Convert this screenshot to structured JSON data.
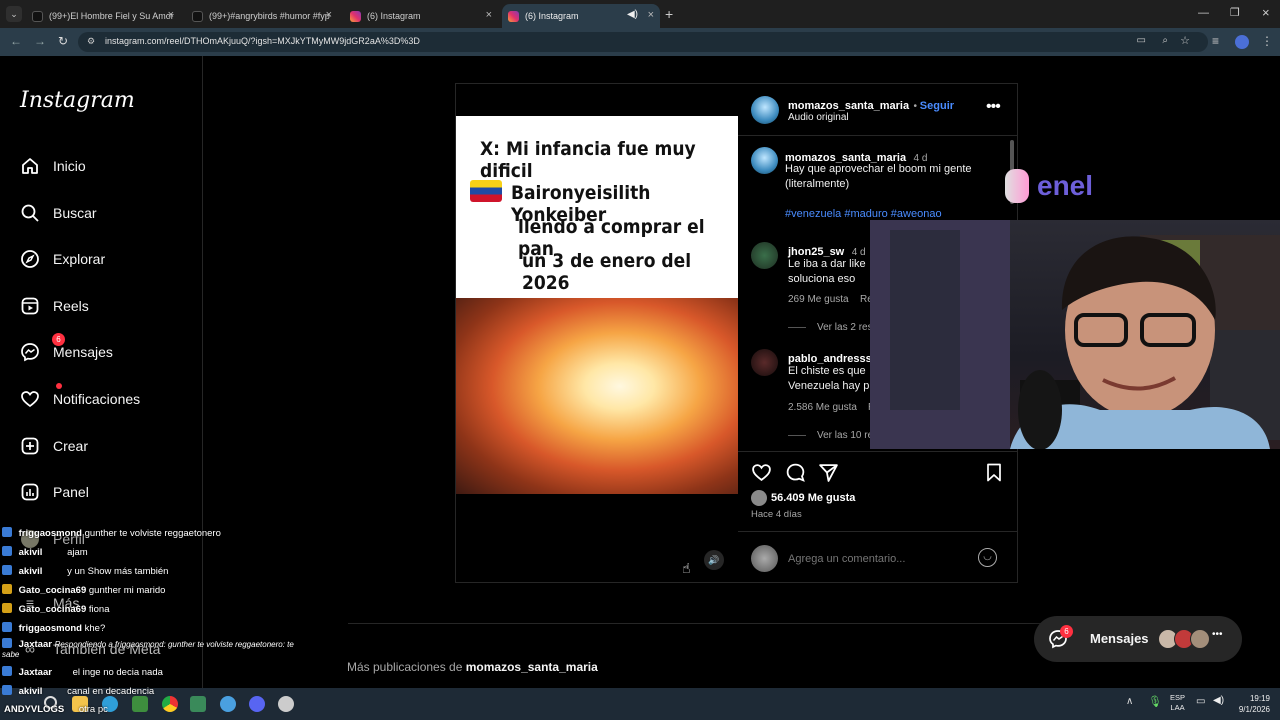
{
  "browser": {
    "tabs": [
      {
        "label": "(99+)El Hombre Fiel y Su Amor",
        "icon": "tiktok-icon"
      },
      {
        "label": "(99+)#angrybirds #humor #fyp",
        "icon": "tiktok-icon"
      },
      {
        "label": "(6) Instagram",
        "icon": "instagram-icon"
      },
      {
        "label": "(6) Instagram",
        "icon": "instagram-icon"
      }
    ],
    "url": "instagram.com/reel/DTHOmAKjuuQ/?igsh=MXJkYTMyMW9jdGR2aA%3D%3D"
  },
  "sidebar": {
    "logo": "Instagram",
    "items": [
      {
        "label": "Inicio",
        "icon": "home-icon"
      },
      {
        "label": "Buscar",
        "icon": "search-icon"
      },
      {
        "label": "Explorar",
        "icon": "compass-icon"
      },
      {
        "label": "Reels",
        "icon": "reels-icon"
      },
      {
        "label": "Mensajes",
        "icon": "messenger-icon",
        "badge": "6"
      },
      {
        "label": "Notificaciones",
        "icon": "heart-icon"
      },
      {
        "label": "Crear",
        "icon": "plus-square-icon"
      },
      {
        "label": "Panel",
        "icon": "dashboard-icon"
      },
      {
        "label": "Perfil",
        "icon": "avatar"
      },
      {
        "label": "Más",
        "icon": "menu-icon"
      },
      {
        "label": "También de Meta",
        "icon": "meta-icon"
      }
    ]
  },
  "post": {
    "meme": {
      "line1": "X: Mi infancia fue muy dificil",
      "line2": "Baironyeisilith Yonkeiber",
      "line3": "llendo a comprar el pan",
      "line4": "un 3 de enero del 2026"
    },
    "author": "momazos_santa_maria",
    "follow": "Seguir",
    "audio": "Audio original",
    "caption": {
      "user": "momazos_santa_maria",
      "time": "4 d",
      "text1": "Hay que aprovechar el boom mi gente",
      "text2": "(literalmente)",
      "tags": "#venezuela #maduro #aweonao"
    },
    "comments": [
      {
        "user": "jhon25_sw",
        "time": "4 d",
        "text1": "Le iba a dar like",
        "text2": "soluciona eso",
        "likes": "269 Me gusta",
        "reply": "Re",
        "replies": "Ver las 2 res"
      },
      {
        "user": "pablo_andresss",
        "text1": "El chiste es que",
        "text2": "Venezuela hay p",
        "likes": "2.586 Me gusta",
        "reply": "R",
        "replies": "Ver las 10 re"
      }
    ],
    "likes": "56.409 Me gusta",
    "date": "Hace 4 días",
    "comment_placeholder": "Agrega un comentario..."
  },
  "more_posts": {
    "prefix": "Más publicaciones de ",
    "user": "momazos_santa_maria"
  },
  "messages_button": {
    "label": "Mensajes",
    "badge": "6"
  },
  "overlay": {
    "enel": "enel"
  },
  "chat": [
    {
      "user": "friggaosmond",
      "msg": "gunther te volviste reggaetonero",
      "badge_color": "#3a7bd5"
    },
    {
      "user": "akivil",
      "msg": "ajam",
      "badge_color": "#3a7bd5"
    },
    {
      "user": "akivil",
      "msg": "y un Show más también",
      "badge_color": "#3a7bd5"
    },
    {
      "user": "Gato_cocina69",
      "msg": "gunther mi marido",
      "badge_color": "#d4a017"
    },
    {
      "user": "Gato_cocina69",
      "msg": "fiona",
      "badge_color": "#d4a017"
    },
    {
      "user": "friggaosmond",
      "msg": "khe?",
      "badge_color": "#3a7bd5"
    },
    {
      "user": "Jaxtaar",
      "msg": "Respondiendo a friggaosmond: gunther te volviste reggaetonero: te sabe",
      "badge_color": "#3a7bd5"
    },
    {
      "user": "Jaxtaar",
      "msg": "el inge no decia nada",
      "badge_color": "#3a7bd5"
    },
    {
      "user": "akivil",
      "msg": "canal en decadencia",
      "badge_color": "#3a7bd5"
    },
    {
      "user": "ANDYVLOGS",
      "msg": "otra pc",
      "badge_color": "#3a7bd5"
    }
  ],
  "taskbar": {
    "lang1": "ESP",
    "lang2": "LAA",
    "time": "19:19",
    "date": "9/1/2026"
  }
}
